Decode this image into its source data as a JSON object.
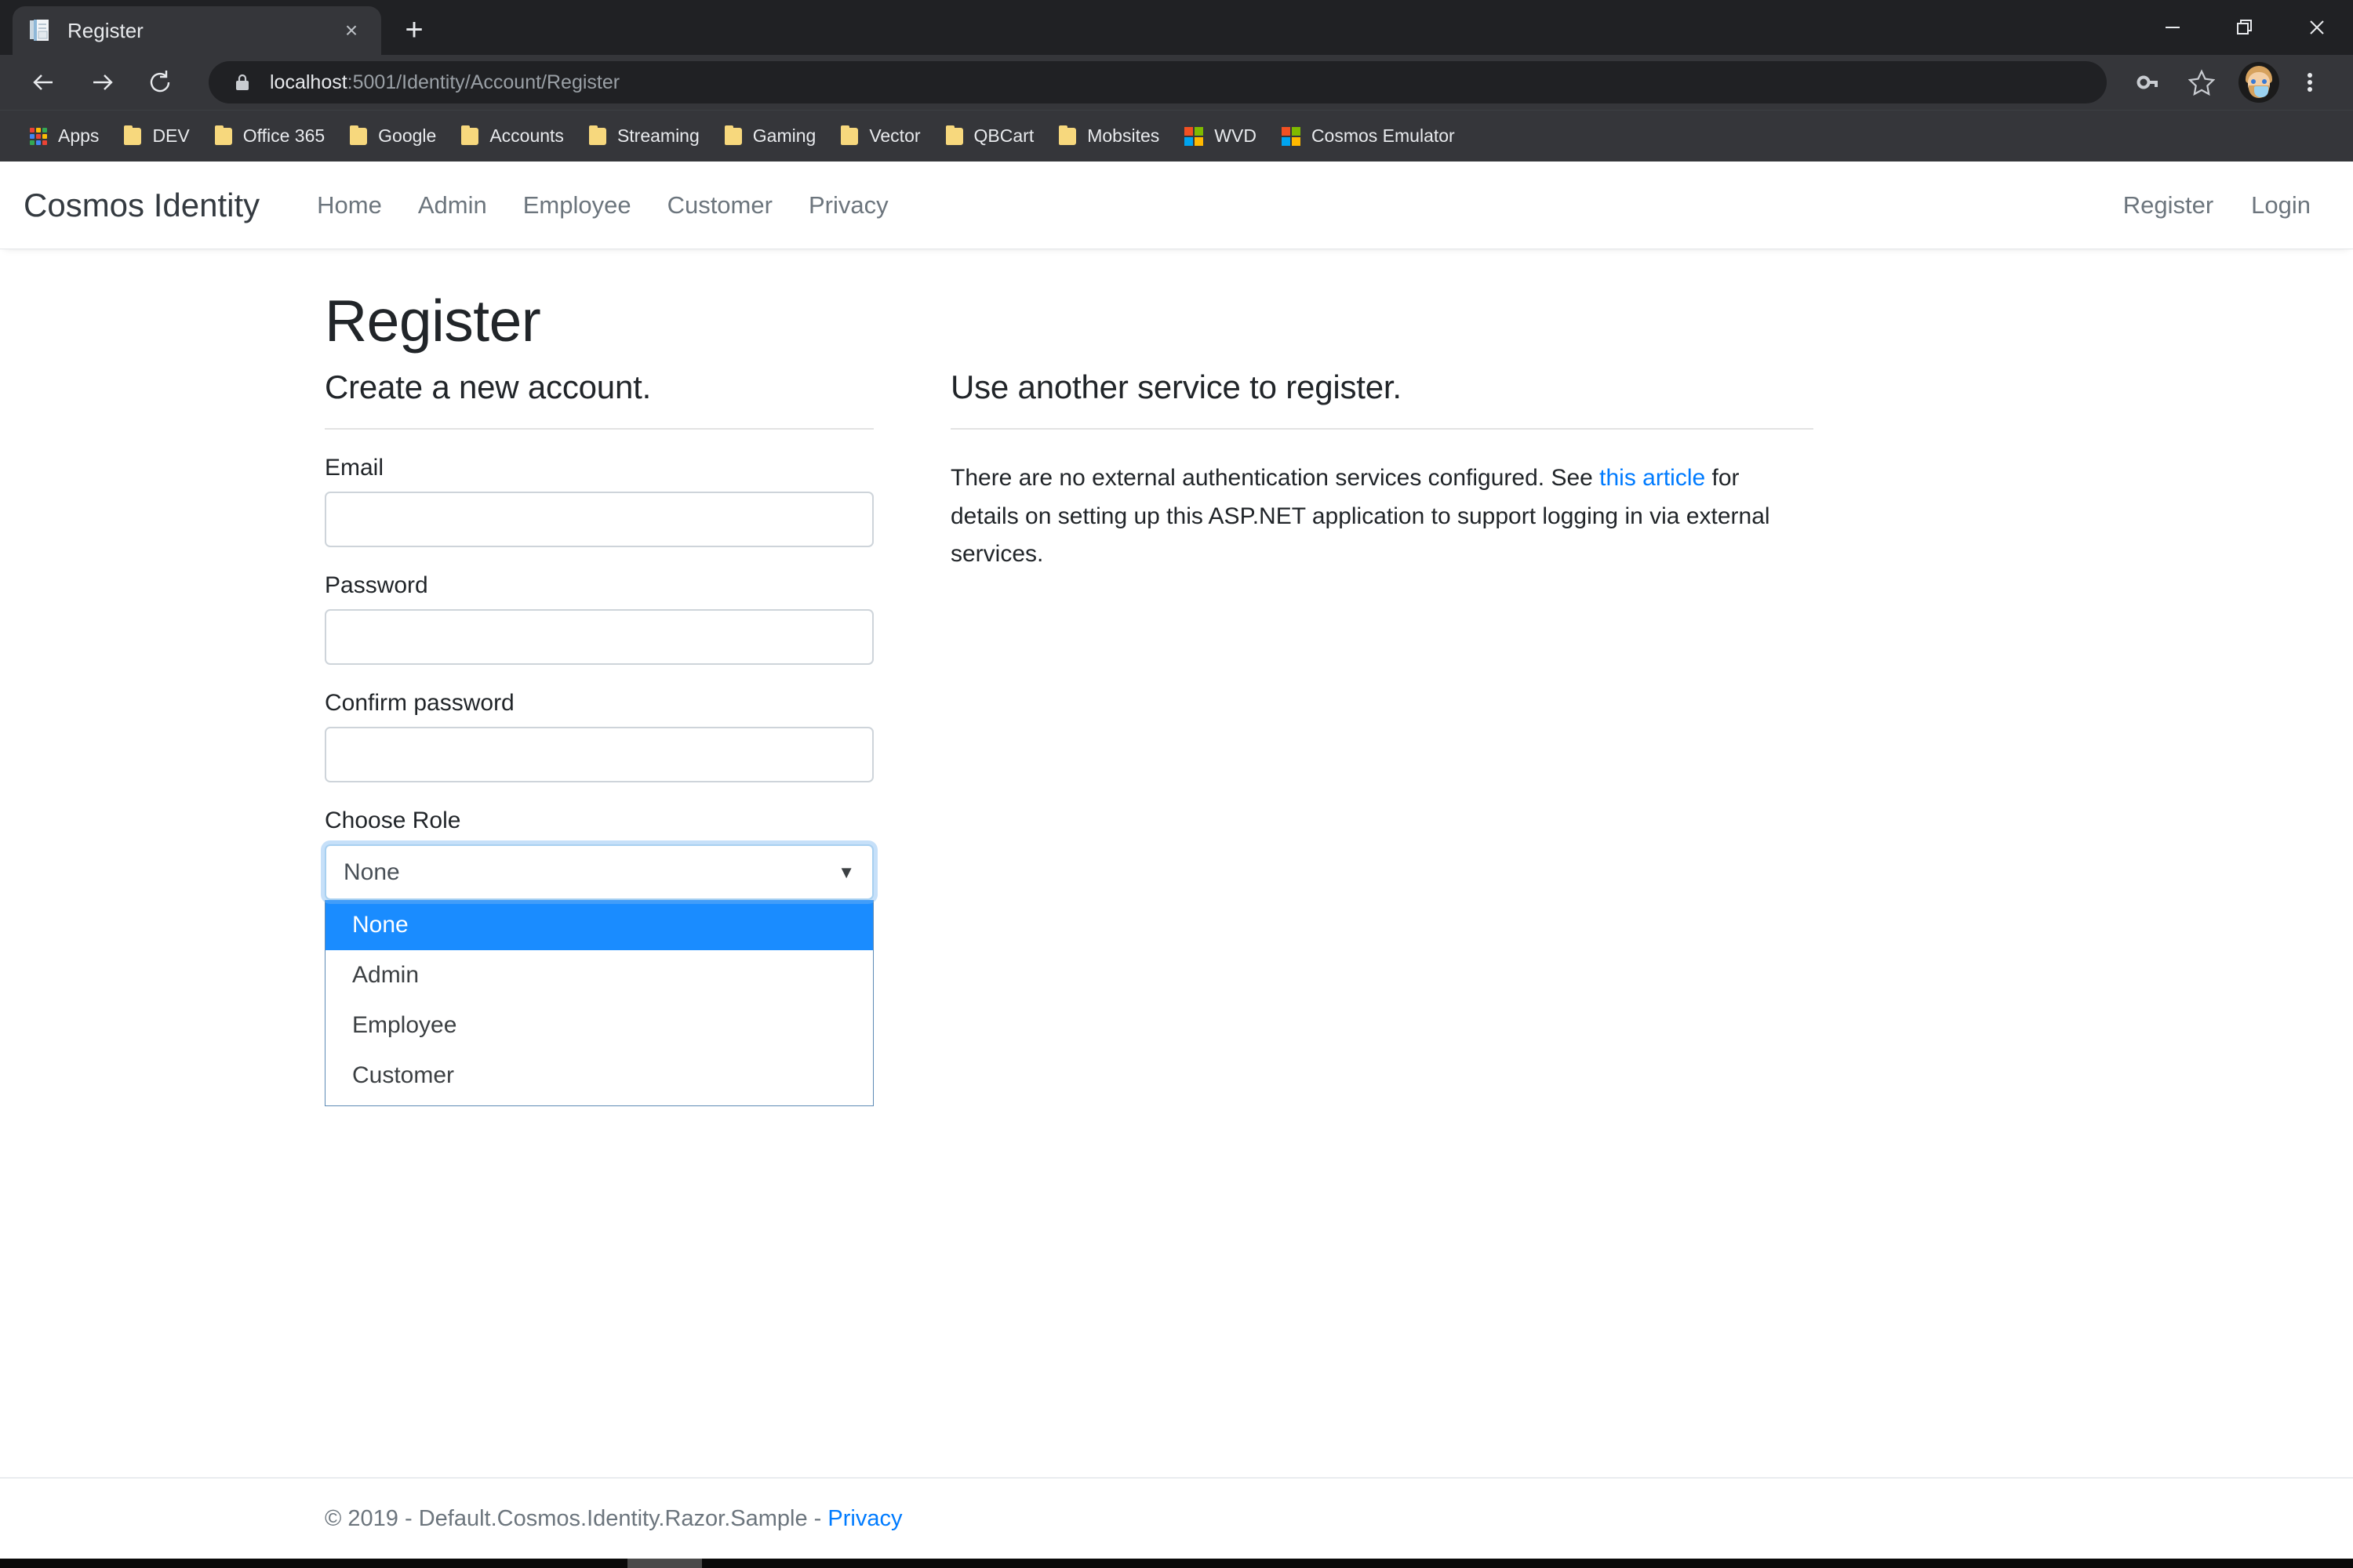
{
  "browser": {
    "tab": {
      "title": "Register",
      "favicon": "document-pages-icon",
      "close": "×"
    },
    "new_tab": "+",
    "window_controls": {
      "minimize": "minimize-icon",
      "maximize": "restore-icon",
      "close": "close-icon"
    },
    "nav": {
      "back": "←",
      "forward": "→",
      "reload": "⟳"
    },
    "omnibox": {
      "lock": "lock-icon",
      "url_host": "localhost",
      "url_rest": ":5001/Identity/Account/Register",
      "url_full": "localhost:5001/Identity/Account/Register"
    },
    "toolbar_icons": {
      "password": "key-icon",
      "bookmark": "star-icon",
      "menu": "three-dot-menu-icon"
    },
    "profile": "profile-avatar",
    "bookmarks": [
      {
        "label": "Apps",
        "icon": "apps-grid-icon"
      },
      {
        "label": "DEV",
        "icon": "folder-icon"
      },
      {
        "label": "Office 365",
        "icon": "folder-icon"
      },
      {
        "label": "Google",
        "icon": "folder-icon"
      },
      {
        "label": "Accounts",
        "icon": "folder-icon"
      },
      {
        "label": "Streaming",
        "icon": "folder-icon"
      },
      {
        "label": "Gaming",
        "icon": "folder-icon"
      },
      {
        "label": "Vector",
        "icon": "folder-icon"
      },
      {
        "label": "QBCart",
        "icon": "folder-icon"
      },
      {
        "label": "Mobsites",
        "icon": "folder-icon"
      },
      {
        "label": "WVD",
        "icon": "microsoft-logo-icon"
      },
      {
        "label": "Cosmos Emulator",
        "icon": "microsoft-logo-icon"
      }
    ]
  },
  "site": {
    "brand": "Cosmos Identity",
    "nav_links": [
      "Home",
      "Admin",
      "Employee",
      "Customer",
      "Privacy"
    ],
    "nav_right": [
      "Register",
      "Login"
    ]
  },
  "page": {
    "title": "Register",
    "left": {
      "heading": "Create a new account.",
      "fields": [
        {
          "label": "Email",
          "value": "",
          "placeholder": "",
          "type": "email",
          "name": "email-field"
        },
        {
          "label": "Password",
          "value": "",
          "placeholder": "",
          "type": "password",
          "name": "password-field"
        },
        {
          "label": "Confirm password",
          "value": "",
          "placeholder": "",
          "type": "password",
          "name": "confirm-password-field"
        }
      ],
      "role": {
        "label": "Choose Role",
        "selected": "None",
        "arrow": "▼",
        "options": [
          "None",
          "Admin",
          "Employee",
          "Customer"
        ],
        "open": true,
        "highlight_color": "#1a8cff"
      }
    },
    "right": {
      "heading": "Use another service to register.",
      "paragraph_before": "There are no external authentication services configured. See ",
      "link_text": "this article",
      "paragraph_after": " for details on setting up this ASP.NET application to support logging in via external services."
    }
  },
  "footer": {
    "copyright": "© 2019 - Default.Cosmos.Identity.Razor.Sample - ",
    "privacy_link": "Privacy"
  }
}
